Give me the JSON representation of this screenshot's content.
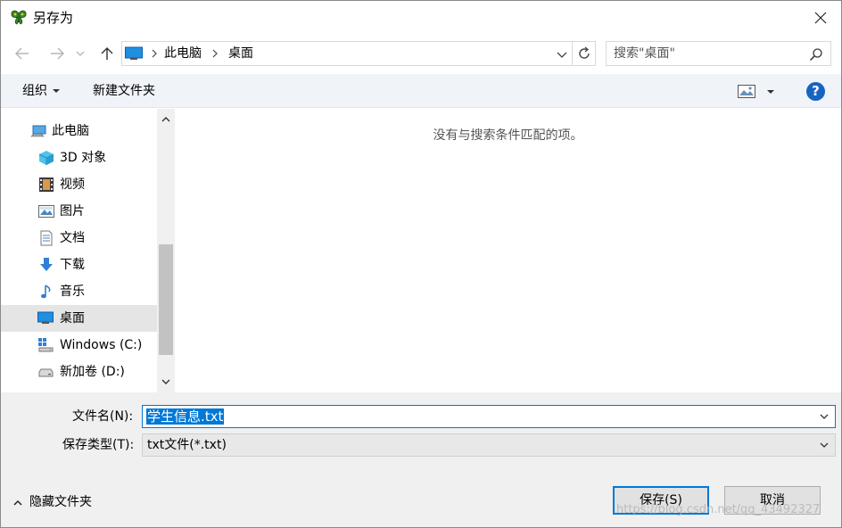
{
  "window": {
    "title": "另存为"
  },
  "address": {
    "crumbs": [
      "此电脑",
      "桌面"
    ]
  },
  "search": {
    "placeholder": "搜索\"桌面\""
  },
  "toolbar": {
    "organize": "组织",
    "new_folder": "新建文件夹",
    "help": "?"
  },
  "nav": {
    "items": [
      {
        "label": "此电脑",
        "icon": "pc-icon"
      },
      {
        "label": "3D 对象",
        "icon": "cube-3d-icon"
      },
      {
        "label": "视频",
        "icon": "video-icon"
      },
      {
        "label": "图片",
        "icon": "pictures-icon"
      },
      {
        "label": "文档",
        "icon": "document-icon"
      },
      {
        "label": "下载",
        "icon": "download-icon"
      },
      {
        "label": "音乐",
        "icon": "music-icon"
      },
      {
        "label": "桌面",
        "icon": "desktop-icon",
        "selected": true
      },
      {
        "label": "Windows (C:)",
        "icon": "drive-c-icon"
      },
      {
        "label": "新加卷 (D:)",
        "icon": "drive-d-icon"
      }
    ]
  },
  "content": {
    "empty_message": "没有与搜索条件匹配的项。"
  },
  "form": {
    "filename_label": "文件名(N):",
    "filename_value": "学生信息.txt",
    "filetype_label": "保存类型(T):",
    "filetype_value": "txt文件(*.txt)"
  },
  "footer": {
    "hide_folders": "隐藏文件夹",
    "save": "保存(S)",
    "cancel": "取消",
    "watermark": "https://blog.csdn.net/qq_43492327"
  },
  "colors": {
    "accent": "#0078d7",
    "help": "#1664c0",
    "toolbar_bg": "#f0f4f9"
  }
}
